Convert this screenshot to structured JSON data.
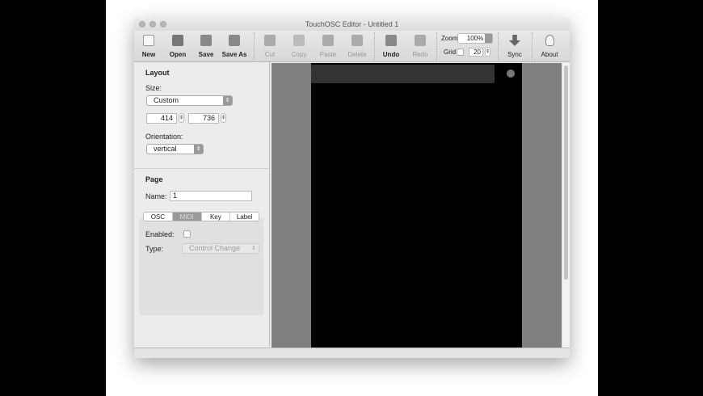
{
  "window": {
    "title": "TouchOSC Editor - Untitled 1"
  },
  "toolbar": {
    "buttons": [
      {
        "label": "New",
        "icon": "new-document-icon",
        "enabled": true
      },
      {
        "label": "Open",
        "icon": "folder-icon",
        "enabled": true
      },
      {
        "label": "Save",
        "icon": "save-icon",
        "enabled": true
      },
      {
        "label": "Save As",
        "icon": "save-as-icon",
        "enabled": true
      },
      {
        "label": "Cut",
        "icon": "scissors-icon",
        "enabled": false
      },
      {
        "label": "Copy",
        "icon": "copy-icon",
        "enabled": false
      },
      {
        "label": "Paste",
        "icon": "clipboard-icon",
        "enabled": false
      },
      {
        "label": "Delete",
        "icon": "delete-icon",
        "enabled": false
      },
      {
        "label": "Undo",
        "icon": "undo-icon",
        "enabled": true
      },
      {
        "label": "Redo",
        "icon": "redo-icon",
        "enabled": false
      }
    ],
    "zoom_label": "Zoom",
    "zoom_value": "100%",
    "grid_label": "Grid",
    "grid_value": "20",
    "sync_label": "Sync",
    "about_label": "About"
  },
  "layout": {
    "heading": "Layout",
    "size_label": "Size:",
    "size_value": "Custom",
    "width": "414",
    "height": "736",
    "orientation_label": "Orientation:",
    "orientation_value": "vertical"
  },
  "page": {
    "heading": "Page",
    "name_label": "Name:",
    "name_value": "1",
    "tabs": [
      {
        "label": "OSC"
      },
      {
        "label": "MIDI"
      },
      {
        "label": "Key"
      },
      {
        "label": "Label"
      }
    ],
    "enabled_label": "Enabled:",
    "type_label": "Type:",
    "type_value": "Control Change"
  }
}
